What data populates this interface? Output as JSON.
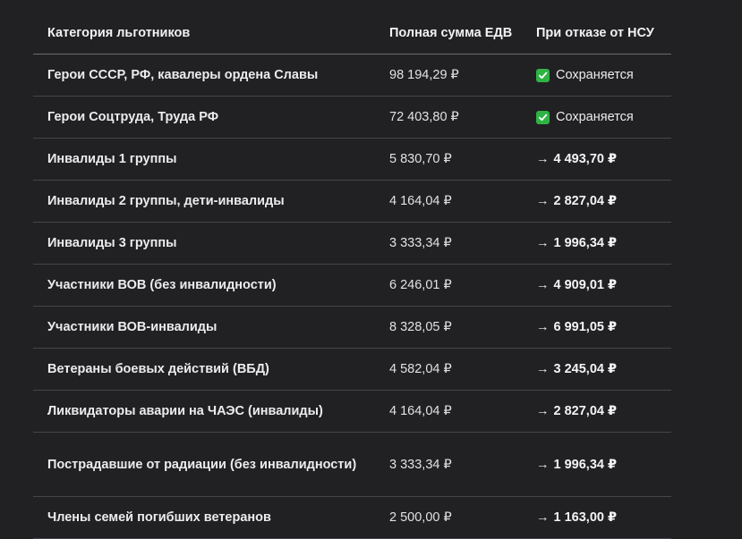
{
  "header": {
    "col_category": "Категория льготников",
    "col_full_sum": "Полная сумма ЕДВ",
    "col_refusal": "При отказе от НСУ"
  },
  "rows": [
    {
      "category": "Герои СССР, РФ, кавалеры ордена Славы",
      "full": "98 194,29 ₽",
      "refusal": "Сохраняется",
      "retained": true
    },
    {
      "category": "Герои Соцтруда, Труда РФ",
      "full": "72 403,80 ₽",
      "refusal": "Сохраняется",
      "retained": true
    },
    {
      "category": "Инвалиды 1 группы",
      "full": "5 830,70 ₽",
      "refusal": "4 493,70 ₽",
      "retained": false
    },
    {
      "category": "Инвалиды 2 группы, дети-инвалиды",
      "full": "4 164,04 ₽",
      "refusal": "2 827,04 ₽",
      "retained": false
    },
    {
      "category": "Инвалиды 3 группы",
      "full": "3 333,34 ₽",
      "refusal": "1 996,34 ₽",
      "retained": false
    },
    {
      "category": "Участники ВОВ (без инвалидности)",
      "full": "6 246,01 ₽",
      "refusal": "4 909,01 ₽",
      "retained": false
    },
    {
      "category": "Участники ВОВ-инвалиды",
      "full": "8 328,05 ₽",
      "refusal": "6 991,05 ₽",
      "retained": false
    },
    {
      "category": "Ветераны боевых действий (ВБД)",
      "full": "4 582,04 ₽",
      "refusal": "3 245,04 ₽",
      "retained": false
    },
    {
      "category": "Ликвидаторы аварии на ЧАЭС (инвалиды)",
      "full": "4 164,04 ₽",
      "refusal": "2 827,04 ₽",
      "retained": false
    },
    {
      "category": "Пострадавшие от радиации (без инвалидности)",
      "full": "3 333,34 ₽",
      "refusal": "1 996,34 ₽",
      "retained": false
    },
    {
      "category": "Члены семей погибших ветеранов",
      "full": "2 500,00 ₽",
      "refusal": "1 163,00 ₽",
      "retained": false
    }
  ],
  "icons": {
    "arrow": "→",
    "check_color": "#2fb344"
  }
}
